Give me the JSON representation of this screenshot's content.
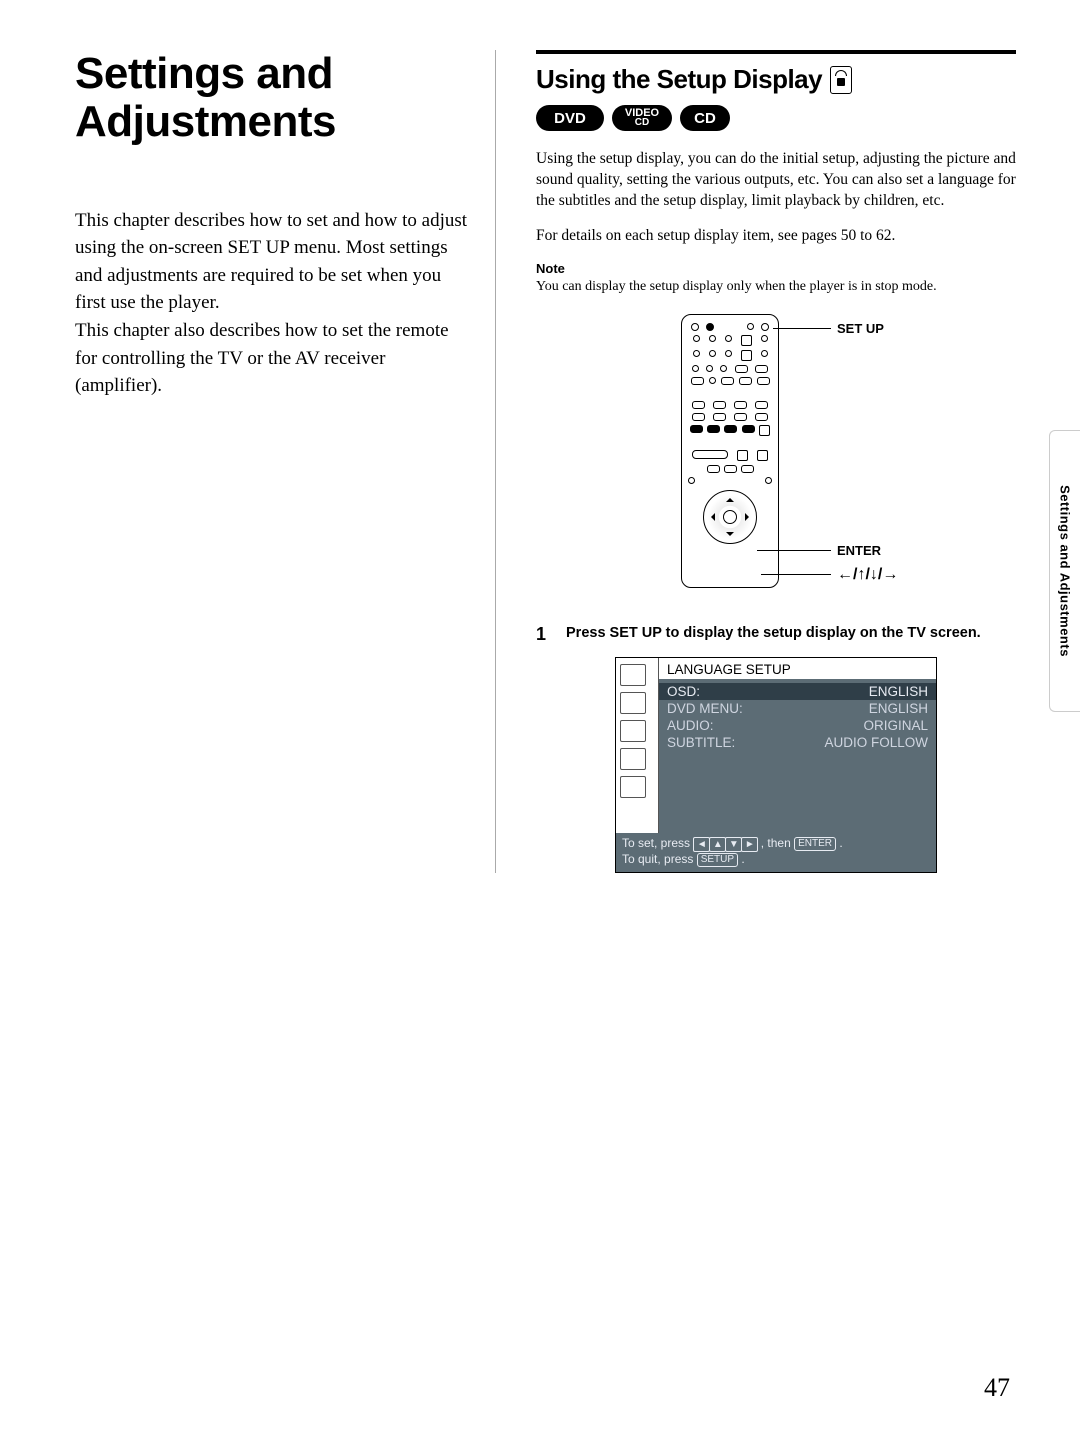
{
  "page_number": "47",
  "side_tab": "Settings and Adjustments",
  "left": {
    "chapter_title": "Settings and Adjustments",
    "intro": "This chapter describes how to set and how to adjust using the on-screen SET UP menu.  Most settings and adjustments are required to be set when you first use the player.\nThis chapter also describes how to set the remote for controlling the TV or the AV receiver (amplifier)."
  },
  "right": {
    "section_title": "Using the Setup Display",
    "badges": {
      "dvd": "DVD",
      "vcd_top": "VIDEO",
      "vcd_bottom": "CD",
      "cd": "CD"
    },
    "para1": "Using the setup display, you can do the initial setup, adjusting the picture and sound quality, setting the various outputs, etc.  You can also set a language for the subtitles and the setup display, limit playback by children, etc.",
    "para2": "For details on each setup display item, see pages 50 to 62.",
    "note_label": "Note",
    "note_text": "You can display the setup display only when the player is in stop mode.",
    "remote_labels": {
      "setup": "SET UP",
      "enter": "ENTER",
      "arrows": "←/↑/↓/→"
    },
    "step": {
      "num": "1",
      "text": "Press SET UP to display the setup display on the TV screen."
    },
    "tv": {
      "title": "LANGUAGE SETUP",
      "rows": [
        {
          "label": "OSD:",
          "value": "ENGLISH",
          "highlight": true
        },
        {
          "label": "DVD MENU:",
          "value": "ENGLISH",
          "highlight": false
        },
        {
          "label": "AUDIO:",
          "value": "ORIGINAL",
          "highlight": false
        },
        {
          "label": "SUBTITLE:",
          "value": "AUDIO FOLLOW",
          "highlight": false
        }
      ],
      "footer": {
        "line1_prefix": "To set, press ",
        "line1_then": ", then",
        "enter_cap": "ENTER",
        "line1_suffix": " .",
        "line2_prefix": "To quit, press ",
        "setup_cap": "SETUP",
        "line2_suffix": " ."
      }
    }
  }
}
